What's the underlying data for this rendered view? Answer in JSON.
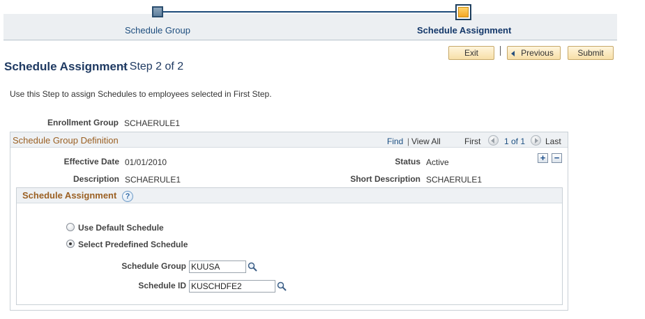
{
  "train": {
    "steps": [
      {
        "label": "Schedule Group",
        "state": "completed"
      },
      {
        "label": "Schedule Assignment",
        "state": "current"
      }
    ]
  },
  "toolbar": {
    "exit_label": "Exit",
    "separator": "|",
    "previous_label": "Previous",
    "submit_label": "Submit"
  },
  "page": {
    "title": "Schedule Assignment",
    "step": "- Step 2 of 2",
    "instructions": "Use this Step to assign Schedules to employees selected in First Step."
  },
  "enrollment": {
    "label": "Enrollment Group",
    "value": "SCHAERULE1"
  },
  "group_box": {
    "title": "Schedule Group Definition",
    "nav": {
      "find": "Find",
      "pipe": "|",
      "view_all": "View All",
      "first": "First",
      "count": "1 of 1",
      "last": "Last"
    },
    "add_label": "+",
    "delete_label": "−",
    "effective_date_label": "Effective Date",
    "effective_date_value": "01/01/2010",
    "status_label": "Status",
    "status_value": "Active",
    "description_label": "Description",
    "description_value": "SCHAERULE1",
    "short_description_label": "Short Description",
    "short_description_value": "SCHAERULE1"
  },
  "assignment": {
    "title": "Schedule Assignment",
    "help_label": "?",
    "options": [
      {
        "label": "Use Default Schedule",
        "checked": false
      },
      {
        "label": "Select Predefined Schedule",
        "checked": true
      }
    ],
    "schedule_group_label": "Schedule Group",
    "schedule_group_value": "KUUSA",
    "schedule_id_label": "Schedule ID",
    "schedule_id_value": "KUSCHDFE2"
  },
  "colors": {
    "accent": "#1f3a62",
    "section_title": "#9b6023",
    "current_step": "#f5a623",
    "button_fill": "#f7dfa8"
  },
  "icons": {
    "lookup": "magnifier-icon",
    "previous": "left-triangle-icon",
    "help": "help-circle-icon"
  }
}
